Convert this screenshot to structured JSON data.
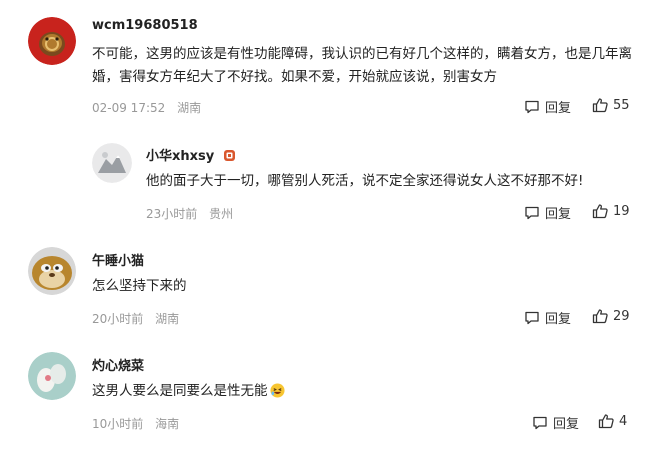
{
  "comments": [
    {
      "username": "wcm19680518",
      "text": "不可能，这男的应该是有性功能障碍，我认识的已有好几个这样的，瞒着女方，也是几年离婚，害得女方年纪大了不好找。如果不爱，开始就应该说，别害女方",
      "time": "02-09 17:52",
      "location": "湖南",
      "reply_label": "回复",
      "likes": "55"
    },
    {
      "username": "小华xhxsy",
      "text": "他的面子大于一切，哪管别人死活，说不定全家还得说女人这不好那不好!",
      "time": "23小时前",
      "location": "贵州",
      "reply_label": "回复",
      "likes": "19"
    },
    {
      "username": "午睡小猫",
      "text": "怎么坚持下来的",
      "time": "20小时前",
      "location": "湖南",
      "reply_label": "回复",
      "likes": "29"
    },
    {
      "username": "灼心烧菜",
      "text": "这男人要么是同要么是性无能",
      "time": "10小时前",
      "location": "海南",
      "reply_label": "回复",
      "likes": "4"
    }
  ],
  "icons": {
    "reply": "comment-bubble-icon",
    "like": "thumbs-up-icon",
    "badge": "user-badge-icon",
    "emoji": "laughing-emoji-icon"
  }
}
